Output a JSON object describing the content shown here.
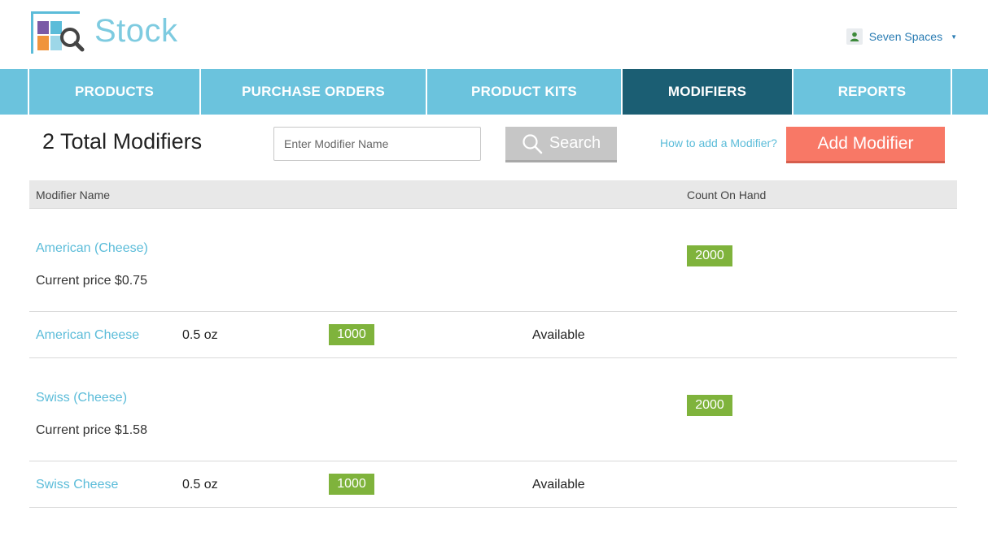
{
  "app": {
    "brand": "Stock",
    "user_name": "Seven Spaces"
  },
  "nav": {
    "items": [
      {
        "label": "PRODUCTS",
        "active": false
      },
      {
        "label": "PURCHASE ORDERS",
        "active": false
      },
      {
        "label": "PRODUCT KITS",
        "active": false
      },
      {
        "label": "MODIFIERS",
        "active": true
      },
      {
        "label": "REPORTS",
        "active": false
      }
    ]
  },
  "toolbar": {
    "total_label": "2 Total Modifiers",
    "search_placeholder": "Enter Modifier Name",
    "search_button": "Search",
    "help_link": "How to add a Modifier?",
    "add_button": "Add Modifier"
  },
  "table": {
    "headers": [
      "Modifier Name",
      "Count On Hand"
    ],
    "modifiers": [
      {
        "name": "American (Cheese)",
        "price": "Current price $0.75",
        "count": "2000",
        "item": {
          "name": "American Cheese",
          "size": "0.5 oz",
          "count": "1000",
          "status": "Available"
        }
      },
      {
        "name": "Swiss (Cheese)",
        "price": "Current price $1.58",
        "count": "2000",
        "item": {
          "name": "Swiss Cheese",
          "size": "0.5 oz",
          "count": "1000",
          "status": "Available"
        }
      }
    ]
  },
  "colors": {
    "nav_bg": "#6bc3dd",
    "nav_active": "#1b5e73",
    "link": "#5bbcd9",
    "badge": "#7fb33c",
    "add_button": "#f87866",
    "search_button": "#c6c6c6"
  },
  "icons": {
    "logo": "stock-logo-icon",
    "user": "user-icon",
    "caret": "caret-down-icon",
    "search": "search-icon"
  }
}
